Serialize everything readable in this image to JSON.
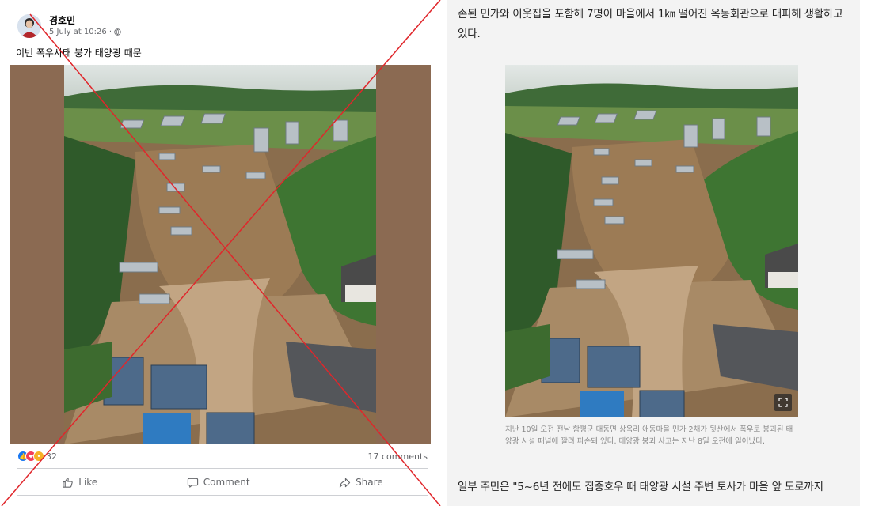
{
  "facebook_post": {
    "author": "경호민",
    "timestamp": "5 July at 10:26 ·",
    "privacy_icon": "globe-icon",
    "post_text": "이번 폭우사태 붕가 태양광 때문",
    "reaction_icons": [
      "like-reaction-icon",
      "love-reaction-icon",
      "wow-reaction-icon"
    ],
    "reaction_count": "32",
    "comments": "17 comments",
    "actions": {
      "like": "Like",
      "comment": "Comment",
      "share": "Share"
    },
    "overlay": "red-x-cross",
    "overlay_color": "#e0262b"
  },
  "article": {
    "paragraph_top": "손된 민가와 이웃집을 포함해 7명이 마을에서 1㎞ 떨어진 옥동회관으로 대피해 생활하고 있다.",
    "caption": "지난 10일 오전 전남 함평군 대동면 상옥리 애동마을 민가 2채가 뒷산에서 폭우로 붕괴된 태양광 시설 패널에 깔려 파손돼 있다. 태양광 붕괴 사고는 지난 8일 오전에 일어났다.",
    "paragraph_bottom": "일부 주민은 \"5~6년 전에도 집중호우 때 태양광 시설 주변 토사가 마을 앞 도로까지",
    "expand_icon": "expand-icon"
  },
  "colors": {
    "facebook_blue": "#1877f2",
    "secondary_text": "#65676b",
    "article_bg": "#f3f3f3",
    "media_frame": "#8b6a52"
  }
}
